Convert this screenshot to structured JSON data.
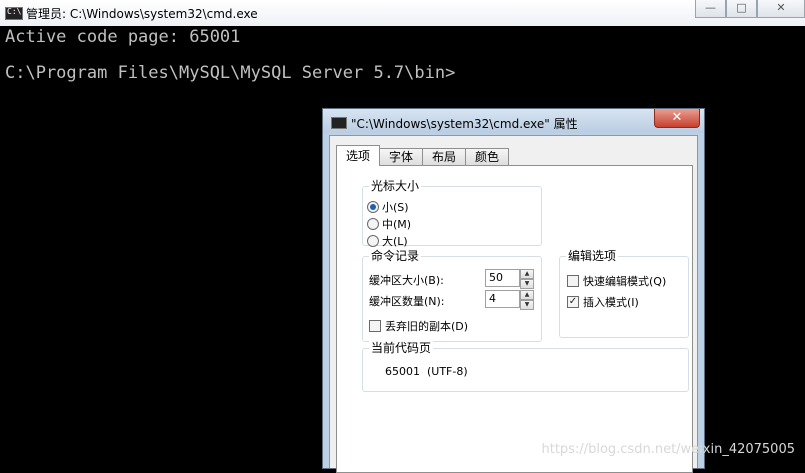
{
  "cmd_window": {
    "title": "管理员: C:\\Windows\\system32\\cmd.exe",
    "caption_buttons": {
      "minimize": "—",
      "maximize": "□",
      "close": "✕"
    }
  },
  "console": {
    "lines": [
      "Active code page: 65001",
      "C:\\Program Files\\MySQL\\MySQL Server 5.7\\bin>"
    ]
  },
  "dialog": {
    "title": "\"C:\\Windows\\system32\\cmd.exe\" 属性",
    "close_label": "✕",
    "tabs": [
      {
        "label": "选项",
        "active": true
      },
      {
        "label": "字体",
        "active": false
      },
      {
        "label": "布局",
        "active": false
      },
      {
        "label": "颜色",
        "active": false
      }
    ],
    "cursor_size": {
      "legend": "光标大小",
      "options": [
        {
          "label": "小(S)",
          "selected": true
        },
        {
          "label": "中(M)",
          "selected": false
        },
        {
          "label": "大(L)",
          "selected": false
        }
      ]
    },
    "command_history": {
      "legend": "命令记录",
      "buffer_size_label": "缓冲区大小(B):",
      "buffer_size_value": "50",
      "buffer_count_label": "缓冲区数量(N):",
      "buffer_count_value": "4",
      "discard_label": "丢弃旧的副本(D)",
      "discard_checked": false
    },
    "edit_options": {
      "legend": "编辑选项",
      "quick_edit_label": "快速编辑模式(Q)",
      "quick_edit_checked": false,
      "insert_mode_label": "插入模式(I)",
      "insert_mode_checked": true
    },
    "code_page": {
      "legend": "当前代码页",
      "value": "65001  (UTF-8)"
    }
  },
  "watermark": "https://blog.csdn.net/weixin_42075005"
}
